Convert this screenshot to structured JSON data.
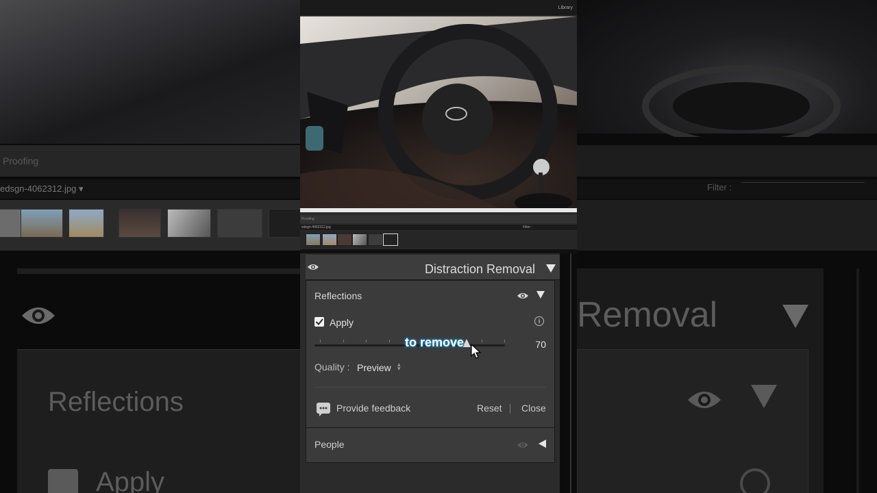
{
  "background": {
    "left_proofing": "Proofing",
    "left_filename": "edsgn-4062312.jpg",
    "left_filename_dropdown": "▾",
    "right_filter": "Filter :",
    "big_removal_text": "Removal",
    "big_reflections_text": "Reflections",
    "big_apply_text": "Apply"
  },
  "mini_ui": {
    "library_label": "Library",
    "proofing": "Proofing",
    "filename": "edsgn-4062312.jpg",
    "filter": "Filter :"
  },
  "panel": {
    "title": "Distraction Removal",
    "reflections": {
      "title": "Reflections",
      "apply_label": "Apply",
      "apply_checked": true,
      "slider_value": "70",
      "slider_fraction": 0.8,
      "quality_label": "Quality :",
      "quality_value": "Preview",
      "feedback_label": "Provide feedback",
      "reset_label": "Reset",
      "separator": "|",
      "close_label": "Close"
    },
    "people": {
      "title": "People"
    }
  },
  "caption": "to remove",
  "colors": {
    "panel_bg": "#3b3b3b",
    "caption_glow": "#2aa8e0"
  }
}
